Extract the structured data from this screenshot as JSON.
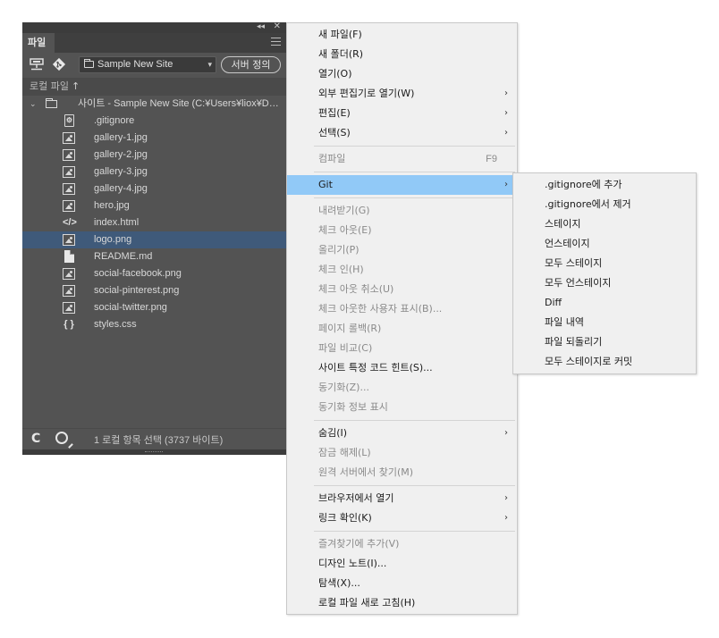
{
  "panel": {
    "tab_label": "파일",
    "site_select_value": "Sample New Site",
    "define_server_label": "서버 정의",
    "local_files_label": "로컬 파일",
    "sort_arrow": "↑",
    "root_label": "사이트 - Sample New Site (C:¥Users¥liox¥Doc...",
    "files": [
      {
        "name": ".gitignore",
        "icon": "gear-doc-icon"
      },
      {
        "name": "gallery-1.jpg",
        "icon": "image-icon"
      },
      {
        "name": "gallery-2.jpg",
        "icon": "image-icon"
      },
      {
        "name": "gallery-3.jpg",
        "icon": "image-icon"
      },
      {
        "name": "gallery-4.jpg",
        "icon": "image-icon"
      },
      {
        "name": "hero.jpg",
        "icon": "image-icon"
      },
      {
        "name": "index.html",
        "icon": "code-icon"
      },
      {
        "name": "logo.png",
        "icon": "image-icon",
        "selected": true
      },
      {
        "name": "README.md",
        "icon": "document-icon"
      },
      {
        "name": "social-facebook.png",
        "icon": "image-icon"
      },
      {
        "name": "social-pinterest.png",
        "icon": "image-icon"
      },
      {
        "name": "social-twitter.png",
        "icon": "image-icon"
      },
      {
        "name": "styles.css",
        "icon": "brace-icon"
      }
    ],
    "status_text": "1 로컬 항목 선택 (3737 바이트)"
  },
  "context_menu": {
    "items": [
      {
        "label": "새 파일(F)",
        "enabled": true
      },
      {
        "label": "새 폴더(R)",
        "enabled": true
      },
      {
        "label": "열기(O)",
        "enabled": true
      },
      {
        "label": "외부 편집기로 열기(W)",
        "enabled": true,
        "submenu": true
      },
      {
        "label": "편집(E)",
        "enabled": true,
        "submenu": true
      },
      {
        "label": "선택(S)",
        "enabled": true,
        "submenu": true
      },
      {
        "separator": true
      },
      {
        "label": "컴파일",
        "enabled": false,
        "shortcut": "F9"
      },
      {
        "separator": true
      },
      {
        "label": "Git",
        "enabled": true,
        "submenu": true,
        "highlighted": true
      },
      {
        "separator": true
      },
      {
        "label": "내려받기(G)",
        "enabled": false
      },
      {
        "label": "체크 아웃(E)",
        "enabled": false
      },
      {
        "label": "올리기(P)",
        "enabled": false
      },
      {
        "label": "체크 인(H)",
        "enabled": false
      },
      {
        "label": "체크 아웃 취소(U)",
        "enabled": false
      },
      {
        "label": "체크 아웃한 사용자 표시(B)...",
        "enabled": false
      },
      {
        "label": "페이지 롤백(R)",
        "enabled": false
      },
      {
        "label": "파일 비교(C)",
        "enabled": false
      },
      {
        "label": "사이트 특정 코드 힌트(S)...",
        "enabled": true
      },
      {
        "label": "동기화(Z)...",
        "enabled": false
      },
      {
        "label": "동기화 정보 표시",
        "enabled": false
      },
      {
        "separator": true
      },
      {
        "label": "숨김(I)",
        "enabled": true,
        "submenu": true
      },
      {
        "label": "잠금 해제(L)",
        "enabled": false
      },
      {
        "label": "원격 서버에서 찾기(M)",
        "enabled": false
      },
      {
        "separator": true
      },
      {
        "label": "브라우저에서 열기",
        "enabled": true,
        "submenu": true
      },
      {
        "label": "링크 확인(K)",
        "enabled": true,
        "submenu": true
      },
      {
        "separator": true
      },
      {
        "label": "즐겨찾기에 추가(V)",
        "enabled": false
      },
      {
        "label": "디자인 노트(I)...",
        "enabled": true
      },
      {
        "label": "탐색(X)...",
        "enabled": true
      },
      {
        "label": "로컬 파일 새로 고침(H)",
        "enabled": true
      }
    ]
  },
  "git_submenu": {
    "items": [
      {
        "label": ".gitignore에 추가"
      },
      {
        "label": ".gitignore에서 제거"
      },
      {
        "label": "스테이지"
      },
      {
        "label": "언스테이지"
      },
      {
        "label": "모두 스테이지"
      },
      {
        "label": "모두 언스테이지"
      },
      {
        "label": "Diff"
      },
      {
        "label": "파일 내역"
      },
      {
        "label": "파일 되돌리기"
      },
      {
        "label": "모두 스테이지로 커밋"
      }
    ]
  },
  "colors": {
    "panel_bg": "#535353",
    "selection": "#3f5a7a",
    "menu_highlight": "#91c9f7",
    "git_red": "#e8e8e8"
  }
}
